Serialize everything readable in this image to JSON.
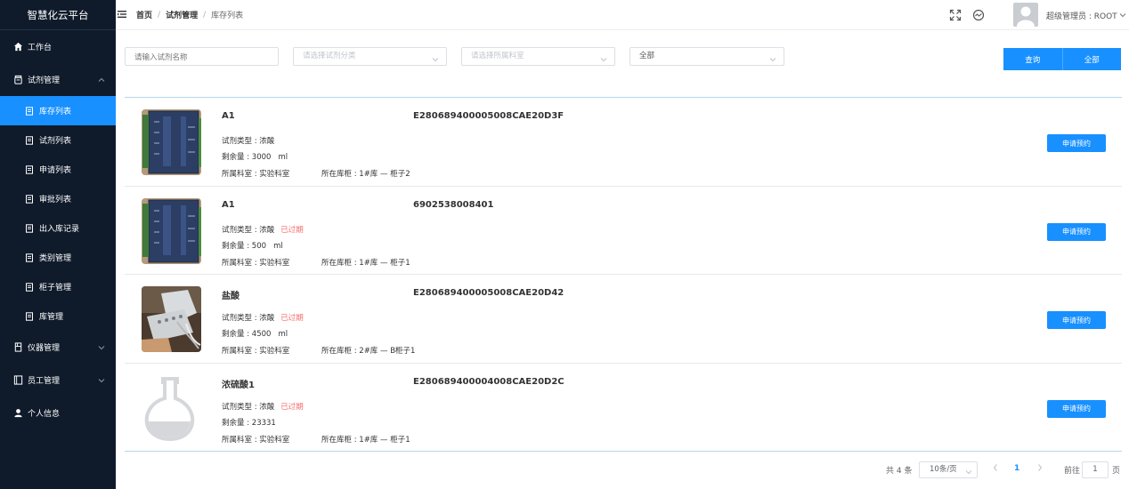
{
  "app": {
    "title": "智慧化云平台"
  },
  "sidebar": {
    "items": [
      {
        "label": "工作台",
        "icon": "home-icon"
      },
      {
        "label": "试剂管理",
        "icon": "reagent-icon",
        "expanded": true
      },
      {
        "label": "仪器管理",
        "icon": "instrument-icon"
      },
      {
        "label": "员工管理",
        "icon": "staff-icon"
      },
      {
        "label": "个人信息",
        "icon": "user-icon"
      }
    ],
    "sub_items": [
      {
        "label": "库存列表",
        "active": true
      },
      {
        "label": "试剂列表"
      },
      {
        "label": "申请列表"
      },
      {
        "label": "审批列表"
      },
      {
        "label": "出入库记录"
      },
      {
        "label": "类别管理"
      },
      {
        "label": "柜子管理"
      },
      {
        "label": "库管理"
      }
    ],
    "active_color": "#1890ff",
    "bg_color": "#0f1b2b"
  },
  "header": {
    "breadcrumb": [
      "首页",
      "试剂管理",
      "库存列表"
    ],
    "breadcrumb_sep": "/",
    "user": "超级管理员 : ROOT"
  },
  "filters": {
    "name_placeholder": "请输入试剂名称",
    "category_placeholder": "请选择试剂分类",
    "lab_placeholder": "请选择所属科室",
    "status_value": "全部"
  },
  "buttons": {
    "query": "查询",
    "all": "全部"
  },
  "list": {
    "labels": {
      "type": "试剂类型 :",
      "remain": "剩余量 :",
      "lab": "所属科室 :",
      "cabinet": "所在库柜 :"
    },
    "apply_label": "申请预约",
    "expired_label": "已过期",
    "rows": [
      {
        "name": "A1",
        "code": "E280689400005008CAE20D3F",
        "type": "浓酸",
        "expired": false,
        "remain": "3000",
        "unit": "ml",
        "lab": "实验科室",
        "cabinet": "1#库 — 柜子2",
        "thumb": "device"
      },
      {
        "name": "A1",
        "code": "6902538008401",
        "type": "浓酸",
        "expired": true,
        "remain": "500",
        "unit": "ml",
        "lab": "实验科室",
        "cabinet": "1#库 — 柜子1",
        "thumb": "device"
      },
      {
        "name": "盐酸",
        "code": "E280689400005008CAE20D42",
        "type": "浓酸",
        "expired": true,
        "remain": "4500",
        "unit": "ml",
        "lab": "实验科室",
        "cabinet": "2#库 — B柜子1",
        "thumb": "lab"
      },
      {
        "name": "浓硫酸1",
        "code": "E280689400004008CAE20D2C",
        "type": "浓酸",
        "expired": true,
        "remain": "23331",
        "unit": "",
        "lab": "实验科室",
        "cabinet": "1#库 — 柜子1",
        "thumb": "flask"
      }
    ]
  },
  "pagination": {
    "total": "共 4 条",
    "page_size": "10条/页",
    "current_page": "1",
    "goto_label": "前往",
    "goto_value": "1",
    "page_suffix": "页"
  }
}
